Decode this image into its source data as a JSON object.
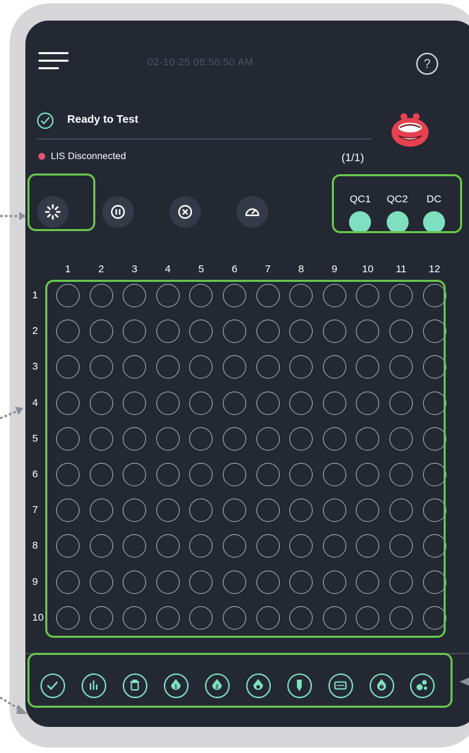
{
  "header": {
    "datetime": "02-10-25 08:56:50 AM",
    "help_label": "?"
  },
  "status": {
    "label": "Ready to Test",
    "lis_label": "LIS Disconnected",
    "count": "(1/1)"
  },
  "controls": [
    {
      "name": "spin-button",
      "icon": "spinner-icon"
    },
    {
      "name": "pause-button",
      "icon": "pause-icon"
    },
    {
      "name": "stop-button",
      "icon": "stop-x-icon"
    },
    {
      "name": "gauge-button",
      "icon": "gauge-icon"
    }
  ],
  "qc": [
    {
      "label": "QC1",
      "color": "#7fe0c1"
    },
    {
      "label": "QC2",
      "color": "#7fe0c1"
    },
    {
      "label": "DC",
      "color": "#7fe0c1"
    }
  ],
  "plate": {
    "columns": [
      "1",
      "2",
      "3",
      "4",
      "5",
      "6",
      "7",
      "8",
      "9",
      "10",
      "11",
      "12"
    ],
    "rows": [
      "1",
      "2",
      "3",
      "4",
      "5",
      "6",
      "7",
      "8",
      "9",
      "10"
    ]
  },
  "tools": [
    "check-icon",
    "bar-chart-icon",
    "trash-icon",
    "drop-1-icon",
    "drop-2-icon",
    "drop-3-icon",
    "marker-icon",
    "rectangle-icon",
    "drop-timer-icon",
    "dots-icon"
  ],
  "colors": {
    "background": "#232833",
    "accent": "#7fe0c1",
    "highlight": "#69c64b",
    "error": "#e1576b"
  }
}
